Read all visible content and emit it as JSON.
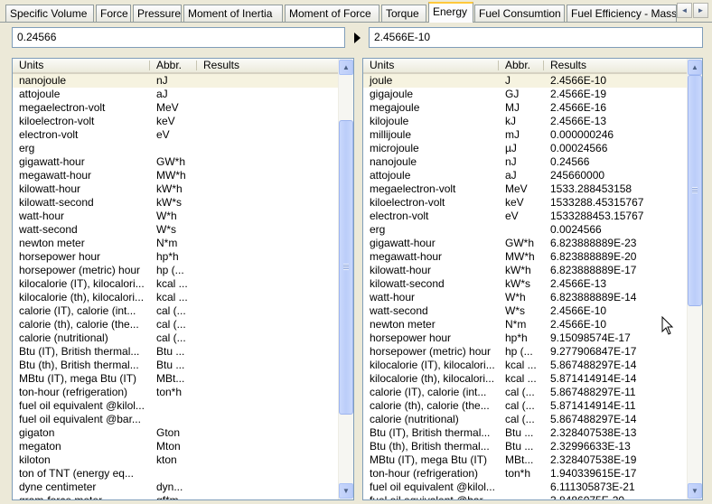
{
  "tabs": [
    {
      "label": "Specific Volume",
      "active": false
    },
    {
      "label": "Force",
      "active": false
    },
    {
      "label": "Pressure",
      "active": false
    },
    {
      "label": "Moment of Inertia",
      "active": false
    },
    {
      "label": "Moment of Force",
      "active": false
    },
    {
      "label": "Torque",
      "active": false
    },
    {
      "label": "Energy",
      "active": true
    },
    {
      "label": "Fuel Consumtion",
      "active": false
    },
    {
      "label": "Fuel Efficiency - Mass",
      "active": false
    }
  ],
  "tab_scroll": {
    "left": "◄",
    "right": "►"
  },
  "input": {
    "value": "0.24566"
  },
  "output": {
    "value": "2.4566E-10"
  },
  "left_table": {
    "columns": {
      "units": "Units",
      "abbr": "Abbr.",
      "results": "Results"
    },
    "rows": [
      {
        "unit": "nanojoule",
        "abbr": "nJ",
        "result": ""
      },
      {
        "unit": "attojoule",
        "abbr": "aJ",
        "result": ""
      },
      {
        "unit": "megaelectron-volt",
        "abbr": "MeV",
        "result": ""
      },
      {
        "unit": "kiloelectron-volt",
        "abbr": "keV",
        "result": ""
      },
      {
        "unit": "electron-volt",
        "abbr": "eV",
        "result": ""
      },
      {
        "unit": "erg",
        "abbr": "",
        "result": ""
      },
      {
        "unit": "gigawatt-hour",
        "abbr": "GW*h",
        "result": ""
      },
      {
        "unit": "megawatt-hour",
        "abbr": "MW*h",
        "result": ""
      },
      {
        "unit": "kilowatt-hour",
        "abbr": "kW*h",
        "result": ""
      },
      {
        "unit": "kilowatt-second",
        "abbr": "kW*s",
        "result": ""
      },
      {
        "unit": "watt-hour",
        "abbr": "W*h",
        "result": ""
      },
      {
        "unit": "watt-second",
        "abbr": "W*s",
        "result": ""
      },
      {
        "unit": "newton meter",
        "abbr": "N*m",
        "result": ""
      },
      {
        "unit": "horsepower hour",
        "abbr": "hp*h",
        "result": ""
      },
      {
        "unit": "horsepower (metric) hour",
        "abbr": "hp (...",
        "result": ""
      },
      {
        "unit": "kilocalorie (IT), kilocalori...",
        "abbr": "kcal ...",
        "result": ""
      },
      {
        "unit": "kilocalorie (th), kilocalori...",
        "abbr": "kcal ...",
        "result": ""
      },
      {
        "unit": "calorie (IT), calorie (int...",
        "abbr": "cal (...",
        "result": ""
      },
      {
        "unit": "calorie (th), calorie (the...",
        "abbr": "cal (...",
        "result": ""
      },
      {
        "unit": "calorie (nutritional)",
        "abbr": "cal (...",
        "result": ""
      },
      {
        "unit": "Btu (IT), British thermal...",
        "abbr": "Btu ...",
        "result": ""
      },
      {
        "unit": "Btu (th), British thermal...",
        "abbr": "Btu ...",
        "result": ""
      },
      {
        "unit": "MBtu (IT), mega Btu (IT)",
        "abbr": "MBt...",
        "result": ""
      },
      {
        "unit": "ton-hour (refrigeration)",
        "abbr": "ton*h",
        "result": ""
      },
      {
        "unit": "fuel oil equivalent @kilol...",
        "abbr": "",
        "result": ""
      },
      {
        "unit": "fuel oil equivalent @bar...",
        "abbr": "",
        "result": ""
      },
      {
        "unit": "gigaton",
        "abbr": "Gton",
        "result": ""
      },
      {
        "unit": "megaton",
        "abbr": "Mton",
        "result": ""
      },
      {
        "unit": "kiloton",
        "abbr": "kton",
        "result": ""
      },
      {
        "unit": "ton of TNT (energy eq...",
        "abbr": "",
        "result": ""
      },
      {
        "unit": "dyne centimeter",
        "abbr": "dyn...",
        "result": ""
      },
      {
        "unit": "gram-force meter",
        "abbr": "gf*m",
        "result": ""
      }
    ]
  },
  "right_table": {
    "columns": {
      "units": "Units",
      "abbr": "Abbr.",
      "results": "Results"
    },
    "rows": [
      {
        "unit": "joule",
        "abbr": "J",
        "result": "2.4566E-10"
      },
      {
        "unit": "gigajoule",
        "abbr": "GJ",
        "result": "2.4566E-19"
      },
      {
        "unit": "megajoule",
        "abbr": "MJ",
        "result": "2.4566E-16"
      },
      {
        "unit": "kilojoule",
        "abbr": "kJ",
        "result": "2.4566E-13"
      },
      {
        "unit": "millijoule",
        "abbr": "mJ",
        "result": "0.000000246"
      },
      {
        "unit": "microjoule",
        "abbr": "µJ",
        "result": "0.00024566"
      },
      {
        "unit": "nanojoule",
        "abbr": "nJ",
        "result": "0.24566"
      },
      {
        "unit": "attojoule",
        "abbr": "aJ",
        "result": "245660000"
      },
      {
        "unit": "megaelectron-volt",
        "abbr": "MeV",
        "result": "1533.288453158"
      },
      {
        "unit": "kiloelectron-volt",
        "abbr": "keV",
        "result": "1533288.45315767"
      },
      {
        "unit": "electron-volt",
        "abbr": "eV",
        "result": "1533288453.15767"
      },
      {
        "unit": "erg",
        "abbr": "",
        "result": "0.0024566"
      },
      {
        "unit": "gigawatt-hour",
        "abbr": "GW*h",
        "result": "6.823888889E-23"
      },
      {
        "unit": "megawatt-hour",
        "abbr": "MW*h",
        "result": "6.823888889E-20"
      },
      {
        "unit": "kilowatt-hour",
        "abbr": "kW*h",
        "result": "6.823888889E-17"
      },
      {
        "unit": "kilowatt-second",
        "abbr": "kW*s",
        "result": "2.4566E-13"
      },
      {
        "unit": "watt-hour",
        "abbr": "W*h",
        "result": "6.823888889E-14"
      },
      {
        "unit": "watt-second",
        "abbr": "W*s",
        "result": "2.4566E-10"
      },
      {
        "unit": "newton meter",
        "abbr": "N*m",
        "result": "2.4566E-10"
      },
      {
        "unit": "horsepower hour",
        "abbr": "hp*h",
        "result": "9.15098574E-17"
      },
      {
        "unit": "horsepower (metric) hour",
        "abbr": "hp (...",
        "result": "9.277906847E-17"
      },
      {
        "unit": "kilocalorie (IT), kilocalori...",
        "abbr": "kcal ...",
        "result": "5.867488297E-14"
      },
      {
        "unit": "kilocalorie (th), kilocalori...",
        "abbr": "kcal ...",
        "result": "5.871414914E-14"
      },
      {
        "unit": "calorie (IT), calorie (int...",
        "abbr": "cal (...",
        "result": "5.867488297E-11"
      },
      {
        "unit": "calorie (th), calorie (the...",
        "abbr": "cal (...",
        "result": "5.871414914E-11"
      },
      {
        "unit": "calorie (nutritional)",
        "abbr": "cal (...",
        "result": "5.867488297E-14"
      },
      {
        "unit": "Btu (IT), British thermal...",
        "abbr": "Btu ...",
        "result": "2.328407538E-13"
      },
      {
        "unit": "Btu (th), British thermal...",
        "abbr": "Btu ...",
        "result": "2.32996633E-13"
      },
      {
        "unit": "MBtu (IT), mega Btu (IT)",
        "abbr": "MBt...",
        "result": "2.328407538E-19"
      },
      {
        "unit": "ton-hour (refrigeration)",
        "abbr": "ton*h",
        "result": "1.940339615E-17"
      },
      {
        "unit": "fuel oil equivalent @kilol...",
        "abbr": "",
        "result": "6.111305873E-21"
      },
      {
        "unit": "fuel oil equivalent @bar...",
        "abbr": "",
        "result": "3.8486075E-20"
      }
    ]
  },
  "icons": {
    "arrow": "play-arrow-icon",
    "scroll_up": "chevron-up-icon",
    "scroll_down": "chevron-down-icon",
    "cursor": "mouse-pointer-icon"
  }
}
